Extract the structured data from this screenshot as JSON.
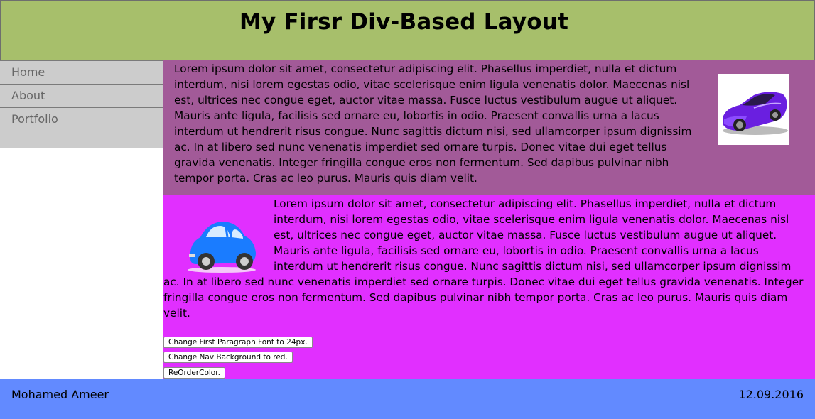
{
  "header": {
    "title": "My Firsr Div-Based Layout"
  },
  "nav": {
    "items": [
      {
        "label": "Home"
      },
      {
        "label": "About"
      },
      {
        "label": "Portfolio"
      }
    ]
  },
  "section1": {
    "text": "Lorem ipsum dolor sit amet, consectetur adipiscing elit. Phasellus imperdiet, nulla et dictum interdum, nisi lorem egestas odio, vitae scelerisque enim ligula venenatis dolor. Maecenas nisl est, ultrices nec congue eget, auctor vitae massa. Fusce luctus vestibulum augue ut aliquet. Mauris ante ligula, facilisis sed ornare eu, lobortis in odio. Praesent convallis urna a lacus interdum ut hendrerit risus congue. Nunc sagittis dictum nisi, sed ullamcorper ipsum dignissim ac. In at libero sed nunc venenatis imperdiet sed ornare turpis. Donec vitae dui eget tellus gravida venenatis. Integer fringilla congue eros non fermentum. Sed dapibus pulvinar nibh tempor porta. Cras ac leo purus. Mauris quis diam velit.",
    "image": "purple-sports-car-icon",
    "background": "#a25a98"
  },
  "section2": {
    "text": "Lorem ipsum dolor sit amet, consectetur adipiscing elit. Phasellus imperdiet, nulla et dictum interdum, nisi lorem egestas odio, vitae scelerisque enim ligula venenatis dolor. Maecenas nisl est, ultrices nec congue eget, auctor vitae massa. Fusce luctus vestibulum augue ut aliquet. Mauris ante ligula, facilisis sed ornare eu, lobortis in odio. Praesent convallis urna a lacus interdum ut hendrerit risus congue. Nunc sagittis dictum nisi, sed ullamcorper ipsum dignissim ac. In at libero sed nunc venenatis imperdiet sed ornare turpis. Donec vitae dui eget tellus gravida venenatis. Integer fringilla congue eros non fermentum. Sed dapibus pulvinar nibh tempor porta. Cras ac leo purus. Mauris quis diam velit.",
    "image": "blue-beetle-car-icon",
    "background": "#e12fff"
  },
  "buttons": {
    "font_button": "Change First Paragraph Font to 24px.",
    "nav_bg_button": "Change Nav Background to red.",
    "reorder_button": "ReOrderColor."
  },
  "footer": {
    "name": "Mohamed Ameer",
    "date": "12.09.2016",
    "background": "#628aff"
  },
  "colors": {
    "header_bg": "#a7bf6b",
    "nav_bg": "#cccccc"
  }
}
